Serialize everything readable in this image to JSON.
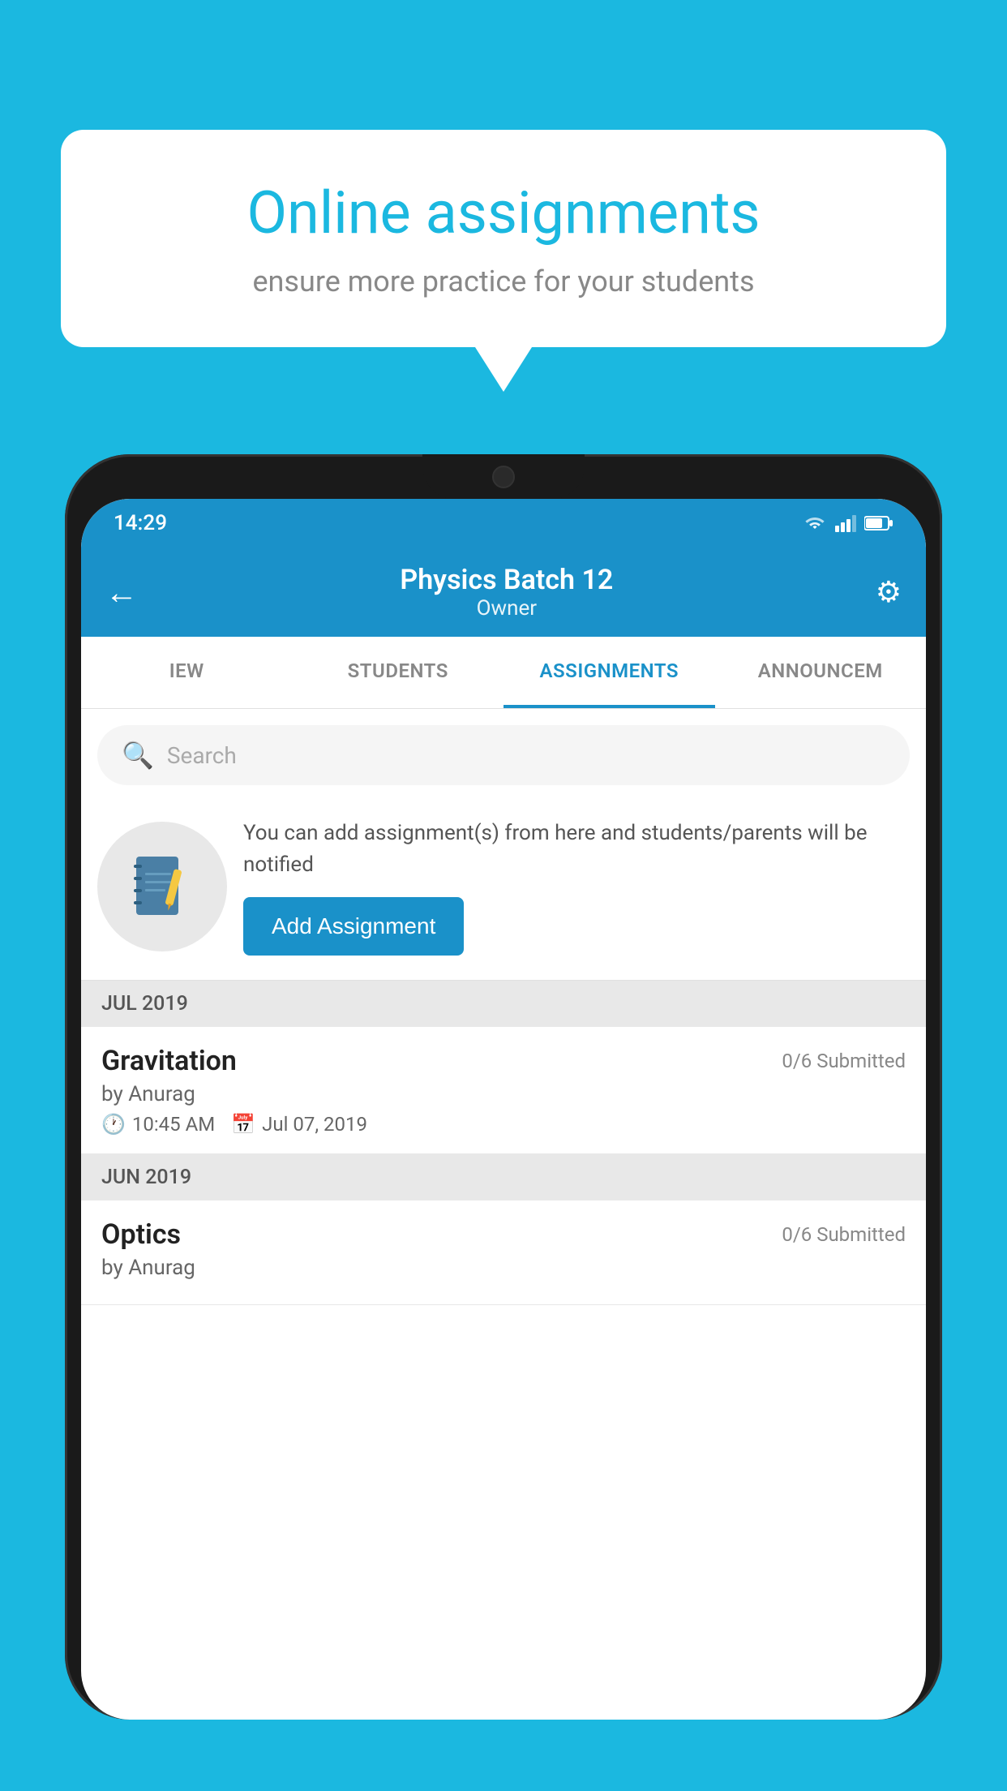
{
  "background_color": "#1bb8e0",
  "speech_bubble": {
    "title": "Online assignments",
    "subtitle": "ensure more practice for your students"
  },
  "status_bar": {
    "time": "14:29",
    "icons": [
      "wifi",
      "signal",
      "battery"
    ]
  },
  "app_bar": {
    "title": "Physics Batch 12",
    "subtitle": "Owner",
    "back_label": "←",
    "settings_label": "⚙"
  },
  "tabs": [
    {
      "label": "IEW",
      "active": false
    },
    {
      "label": "STUDENTS",
      "active": false
    },
    {
      "label": "ASSIGNMENTS",
      "active": true
    },
    {
      "label": "ANNOUNCEM",
      "active": false
    }
  ],
  "search": {
    "placeholder": "Search"
  },
  "add_assignment": {
    "description": "You can add assignment(s) from here and students/parents will be notified",
    "button_label": "Add Assignment"
  },
  "sections": [
    {
      "label": "JUL 2019",
      "assignments": [
        {
          "name": "Gravitation",
          "submitted": "0/6 Submitted",
          "author": "by Anurag",
          "time": "10:45 AM",
          "date": "Jul 07, 2019"
        }
      ]
    },
    {
      "label": "JUN 2019",
      "assignments": [
        {
          "name": "Optics",
          "submitted": "0/6 Submitted",
          "author": "by Anurag",
          "time": "",
          "date": ""
        }
      ]
    }
  ]
}
